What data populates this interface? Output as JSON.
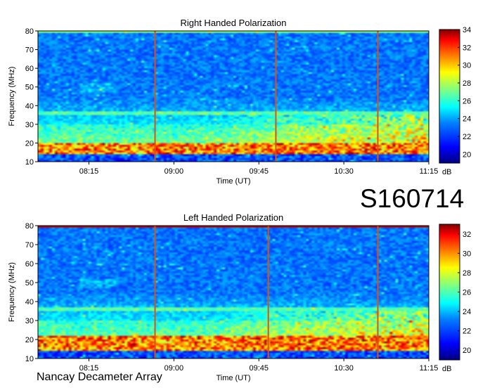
{
  "observation_id": "S160714",
  "credit": "Nancay Decameter Array",
  "colormap": [
    "#00007f",
    "#0000ff",
    "#0080ff",
    "#00ffff",
    "#80ff80",
    "#ffff00",
    "#ff8000",
    "#ff0000",
    "#7f0000"
  ],
  "chart_data": [
    {
      "type": "heatmap",
      "title": "Right Handed Polarization",
      "xlabel": "Time (UT)",
      "ylabel": "Frequency (MHz)",
      "x_ticks": [
        "08:15",
        "09:00",
        "09:45",
        "10:30",
        "11:15"
      ],
      "xlim_minutes": [
        468,
        675
      ],
      "ylim": [
        10,
        80
      ],
      "y_ticks": [
        10,
        20,
        30,
        40,
        50,
        60,
        70,
        80
      ],
      "colorbar": {
        "label": "dB",
        "range": [
          19,
          34
        ],
        "ticks": [
          20,
          22,
          24,
          26,
          28,
          30,
          32,
          34
        ]
      },
      "vertical_bursts_minutes": [
        530,
        594,
        648
      ],
      "strong_band_mhz": [
        10,
        20
      ]
    },
    {
      "type": "heatmap",
      "title": "Left Handed Polarization",
      "xlabel": "Time (UT)",
      "ylabel": "Frequency (MHz)",
      "x_ticks": [
        "08:15",
        "09:00",
        "09:45",
        "10:30",
        "11:15"
      ],
      "xlim_minutes": [
        468,
        675
      ],
      "ylim": [
        10,
        80
      ],
      "y_ticks": [
        10,
        20,
        30,
        40,
        50,
        60,
        70,
        80
      ],
      "colorbar": {
        "label": "dB",
        "range": [
          19,
          33
        ],
        "ticks": [
          20,
          22,
          24,
          26,
          28,
          30,
          32
        ]
      },
      "vertical_bursts_minutes": [
        530,
        590,
        648
      ],
      "strong_band_mhz": [
        10,
        22
      ]
    }
  ]
}
